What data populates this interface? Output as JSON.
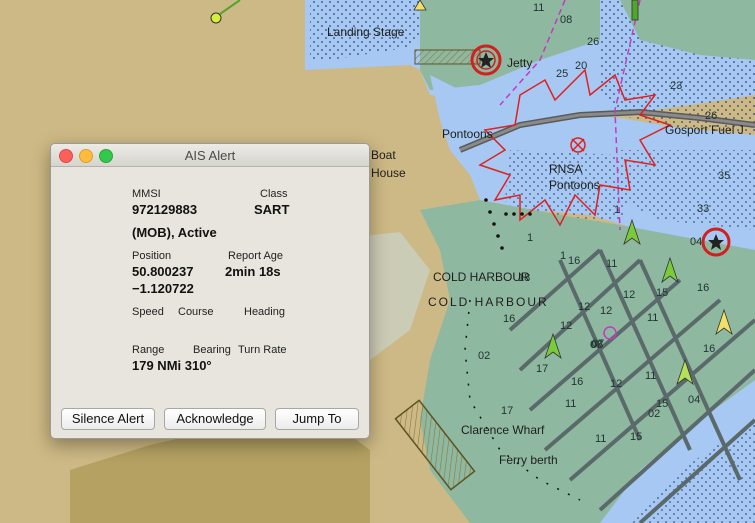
{
  "map": {
    "labels": {
      "landing_stage": "Landing Stage",
      "jetty": "Jetty",
      "pontoons": "Pontoons",
      "boat_house_1": "Boat",
      "boat_house_2": "House",
      "gosport": "Gosport Fuel J",
      "rnsa_1": "RNSA",
      "rnsa_2": "Pontoons",
      "cold_harbour_1": "COLD HARBOUR",
      "cold_harbour_2": "COLD HARBOUR",
      "clarence": "Clarence Wharf",
      "ferry": "Ferry berth"
    },
    "depths": [
      "26",
      "08",
      "11",
      "20",
      "23",
      "15",
      "05",
      "26",
      "35",
      "33",
      "04",
      "18",
      "16",
      "11",
      "12",
      "16",
      "15",
      "12",
      "16",
      "12",
      "08",
      "12",
      "16",
      "11",
      "02",
      "17",
      "07",
      "16",
      "11",
      "12",
      "17",
      "11",
      "15",
      "02",
      "04",
      "15",
      "11",
      "1",
      "1",
      "1",
      "07",
      "25"
    ]
  },
  "ais_alert": {
    "title": "AIS Alert",
    "mmsi_label": "MMSI",
    "mmsi": "972129883",
    "class_label": "Class",
    "class_value": "SART",
    "status": "(MOB), Active",
    "position_label": "Position",
    "position_lat": "50.800237",
    "position_lon": "−1.120722",
    "report_age_label": "Report Age",
    "report_age": "2min 18s",
    "speed_label": "Speed",
    "course_label": "Course",
    "heading_label": "Heading",
    "range_label": "Range",
    "bearing_label": "Bearing",
    "turn_rate_label": "Turn Rate",
    "range_bearing": "179 NMi 310°",
    "buttons": {
      "silence": "Silence Alert",
      "acknowledge": "Acknowledge",
      "jump": "Jump To"
    }
  }
}
